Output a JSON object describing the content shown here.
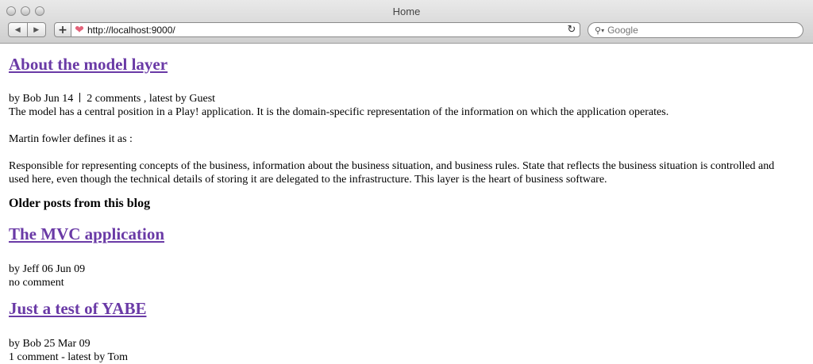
{
  "window": {
    "title": "Home"
  },
  "toolbar": {
    "back_icon": "triangle-left",
    "forward_icon": "triangle-right",
    "add_label": "+",
    "url": "http://localhost:9000/",
    "search_placeholder": "Google"
  },
  "post": {
    "title": "About the model layer",
    "author": "by Bob Jun 14",
    "comments": "2 comments , latest by Guest",
    "paragraphs": [
      "The model has a central position in a Play! application. It is the domain-specific representation of the information on which the application operates.",
      "Martin fowler defines it as :",
      "Responsible for representing concepts of the business, information about the business situation, and business rules. State that reflects the business situation is controlled and used here, even though the technical details of storing it are delegated to the infrastructure. This layer is the heart of business software."
    ]
  },
  "older": {
    "heading": "Older posts from this blog",
    "posts": [
      {
        "title": "The MVC application",
        "meta": "by Jeff 06 Jun 09",
        "comments": "no comment"
      },
      {
        "title": "Just a test of YABE",
        "meta": "by Bob 25 Mar 09",
        "comments": "1 comment - latest by Tom"
      }
    ]
  },
  "colors": {
    "link": "#6a3aa6"
  }
}
